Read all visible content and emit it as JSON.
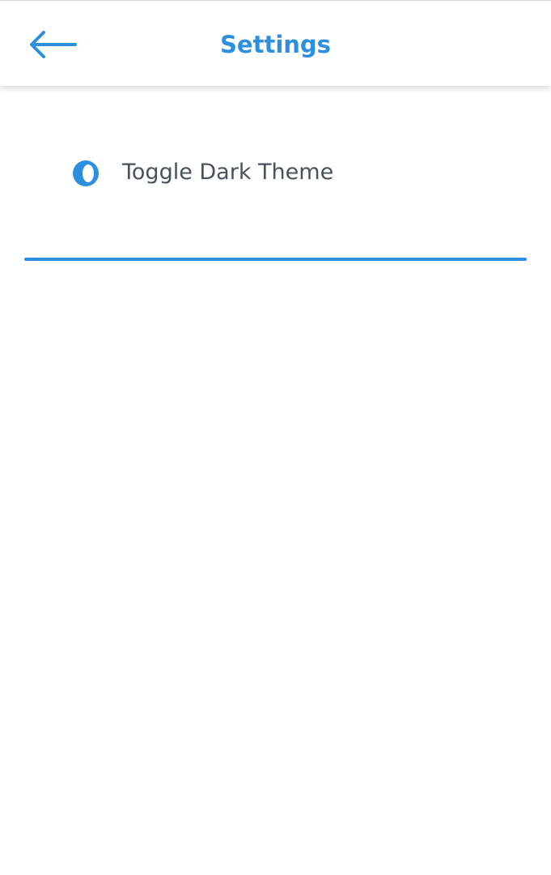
{
  "header": {
    "title": "Settings",
    "back_icon": "arrow-left-icon"
  },
  "settings": {
    "items": [
      {
        "label": "Toggle Dark Theme",
        "icon": "contrast-icon"
      }
    ]
  },
  "colors": {
    "accent": "#2D8FDF",
    "text": "#48515C",
    "background": "#FFFFFF"
  }
}
